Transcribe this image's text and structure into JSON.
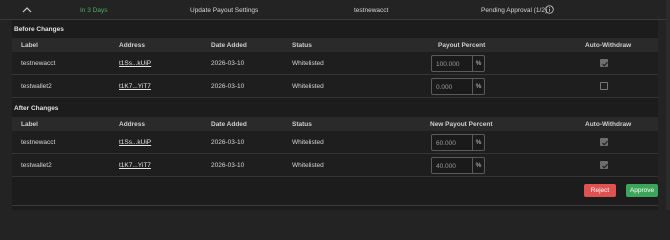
{
  "summary": {
    "timing": "In 3 Days",
    "action": "Update Payout Settings",
    "account": "testnewacct",
    "status": "Pending Approval (1/2)"
  },
  "before": {
    "title": "Before Changes",
    "headers": {
      "label": "Label",
      "address": "Address",
      "date": "Date Added",
      "status": "Status",
      "percent": "Payout Percent",
      "auto": "Auto-Withdraw"
    },
    "rows": [
      {
        "label": "testnewacct",
        "address": "t1Ss...kUiP",
        "date": "2026-03-10",
        "status": "Whitelisted",
        "percent": "100.000",
        "unit": "%",
        "auto_withdraw": true
      },
      {
        "label": "testwallet2",
        "address": "t1K7...YiT7",
        "date": "2026-03-10",
        "status": "Whitelisted",
        "percent": "0.000",
        "unit": "%",
        "auto_withdraw": false
      }
    ]
  },
  "after": {
    "title": "After Changes",
    "headers": {
      "label": "Label",
      "address": "Address",
      "date": "Date Added",
      "status": "Status",
      "percent": "New Payout Percent",
      "auto": "Auto-Withdraw"
    },
    "rows": [
      {
        "label": "testnewacct",
        "address": "t1Ss...kUiP",
        "date": "2026-03-10",
        "status": "Whitelisted",
        "percent": "60.000",
        "unit": "%",
        "auto_withdraw": true
      },
      {
        "label": "testwallet2",
        "address": "t1K7...YiT7",
        "date": "2026-03-10",
        "status": "Whitelisted",
        "percent": "40.000",
        "unit": "%",
        "auto_withdraw": true
      }
    ]
  },
  "actions": {
    "reject_label": "Reject",
    "approve_label": "Approve"
  },
  "colors": {
    "timing": "#4caf6a",
    "reject": "#e05252",
    "approve": "#3da55a"
  },
  "icons": {
    "collapse": "chevron-up-icon",
    "info": "info-icon",
    "check": "check-icon"
  }
}
